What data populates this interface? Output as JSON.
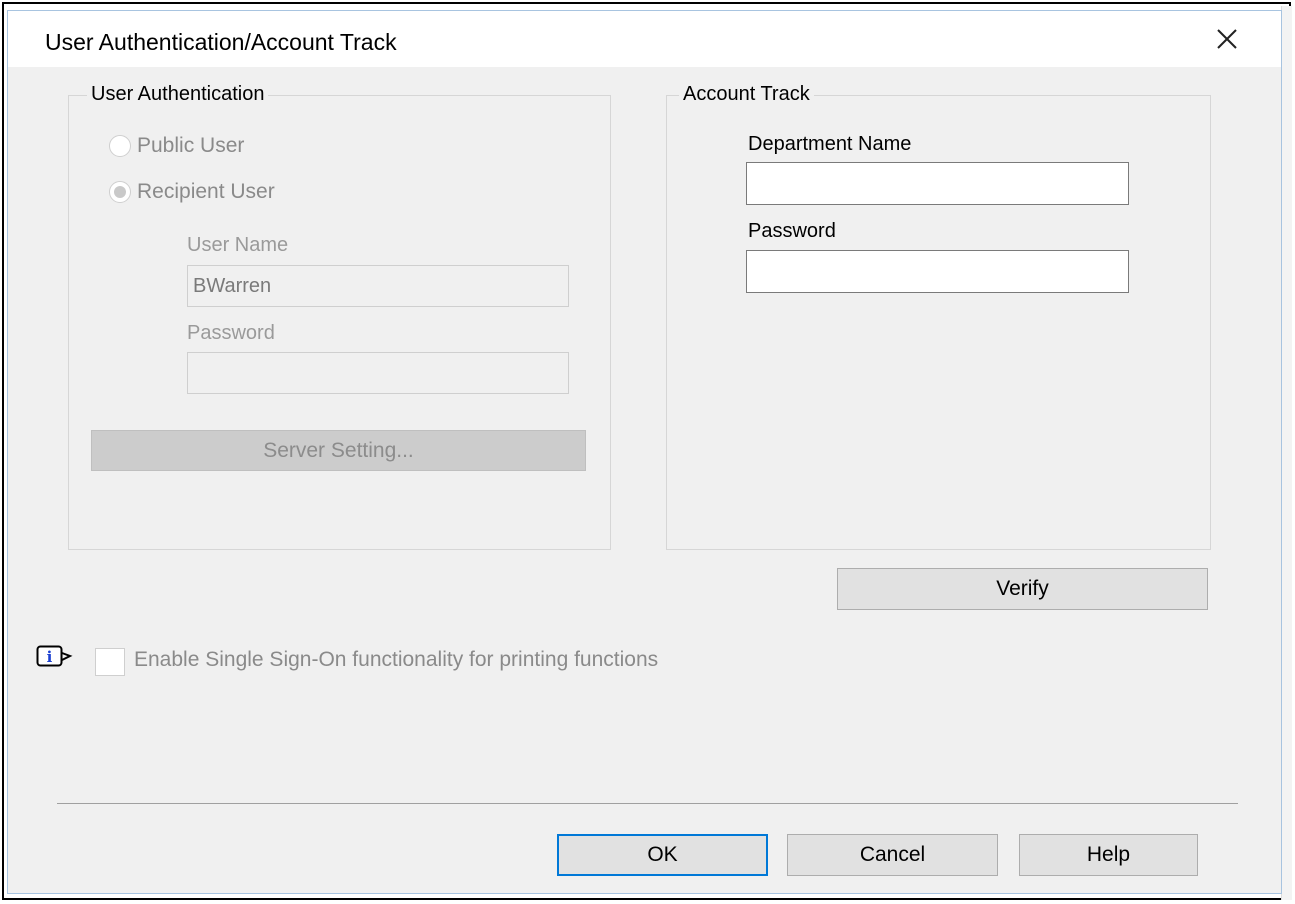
{
  "window": {
    "title": "User Authentication/Account Track"
  },
  "user_auth": {
    "legend": "User Authentication",
    "public_user_label": "Public User",
    "recipient_user_label": "Recipient User",
    "user_name_label": "User Name",
    "user_name_value": "BWarren",
    "password_label": "Password",
    "password_value": "",
    "server_setting_label": "Server Setting..."
  },
  "account_track": {
    "legend": "Account Track",
    "department_name_label": "Department Name",
    "department_name_value": "",
    "password_label": "Password",
    "password_value": "",
    "verify_label": "Verify"
  },
  "sso": {
    "label": "Enable Single Sign-On functionality for printing functions",
    "checked": false
  },
  "footer": {
    "ok_label": "OK",
    "cancel_label": "Cancel",
    "help_label": "Help"
  },
  "icons": {
    "close": "close-icon",
    "info": "info-icon"
  },
  "colors": {
    "focus_border": "#0078d7",
    "dialog_bg": "#f0f0f0"
  }
}
